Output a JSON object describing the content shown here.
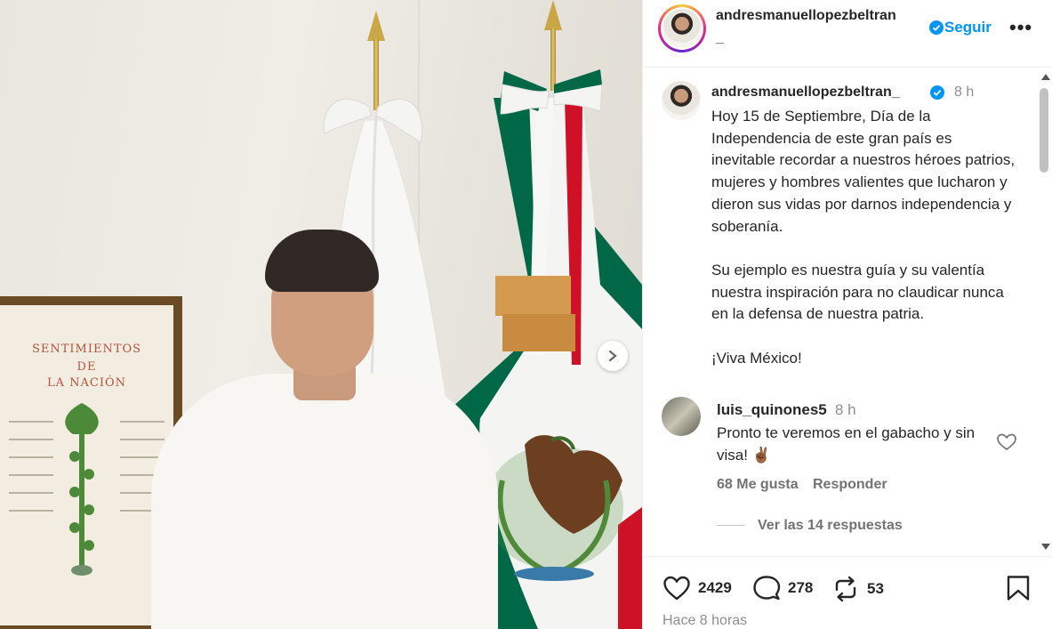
{
  "photo": {
    "frame_title": [
      "SENTIMIENTOS",
      "DE",
      "LA NACIÓN"
    ]
  },
  "header": {
    "username": "andresmanuellopezbeltran",
    "username_tail": "_",
    "follow_label": "Seguir",
    "more_label": "•••"
  },
  "caption": {
    "username": "andresmanuellopezbeltran_",
    "time": "8 h",
    "paragraphs": [
      "Hoy 15 de Septiembre, Día de la Independencia de este gran país es inevitable recordar a nuestros héroes patrios, mujeres y hombres valientes que lucharon y dieron sus vidas por darnos independencia y soberanía.",
      "Su ejemplo es nuestra guía y su valentía nuestra inspiración para no claudicar nunca en la defensa de nuestra patria.",
      "¡Viva México!"
    ]
  },
  "comment": {
    "username": "luis_quinones5",
    "time": "8 h",
    "text": "Pronto te veremos en el gabacho y sin visa! ✌🏾",
    "likes": "68 Me gusta",
    "reply_label": "Responder",
    "view_replies": "Ver las 14 respuestas"
  },
  "actions": {
    "likes": "2429",
    "comments": "278",
    "reposts": "53",
    "time_ago": "Hace 8 horas"
  },
  "colors": {
    "accent": "#0095f6",
    "text": "#262626",
    "muted": "#8e8e8e",
    "flag_green": "#006847",
    "flag_red": "#ce1126"
  },
  "icons": [
    "chevron-right-icon",
    "verified-icon",
    "heart-icon",
    "comment-icon",
    "repost-icon",
    "bookmark-icon"
  ]
}
